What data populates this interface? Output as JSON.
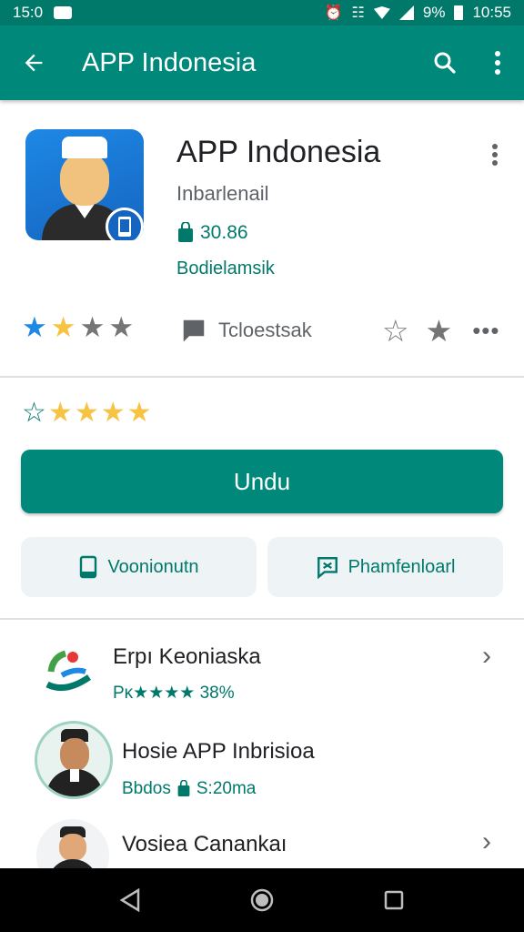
{
  "status_bar": {
    "time": "15:0",
    "battery": "9%",
    "clock": "10:55"
  },
  "app_bar": {
    "title": "APP Indonesia"
  },
  "app": {
    "name": "APP Indonesia",
    "developer": "Inbarlenail",
    "downloads": "30.86",
    "category": "Bodielamsik",
    "rating_stars": 2,
    "review_label": "Tcloestsak"
  },
  "install": {
    "rating_stars": 4,
    "button_label": "Undu",
    "secondary_buttons": [
      {
        "label": "Voonionutn",
        "icon": "phone-icon"
      },
      {
        "label": "Phamfenloarl",
        "icon": "chat-icon"
      }
    ]
  },
  "list": [
    {
      "title": "Erpı Keoniaska",
      "subtitle": "Pᴋ★★★★ 38%"
    },
    {
      "title": "Hosie APP Inbrisioa",
      "subtitle_a": "Bbdos",
      "subtitle_b": "S:20ma"
    },
    {
      "title": "Vosiea Canankaı"
    }
  ],
  "colors": {
    "primary": "#00897b",
    "status_bar": "#00796b",
    "accent_text": "#00796b",
    "star_blue": "#1e88e5",
    "star_yellow": "#f6c343",
    "star_grey": "#757575"
  }
}
